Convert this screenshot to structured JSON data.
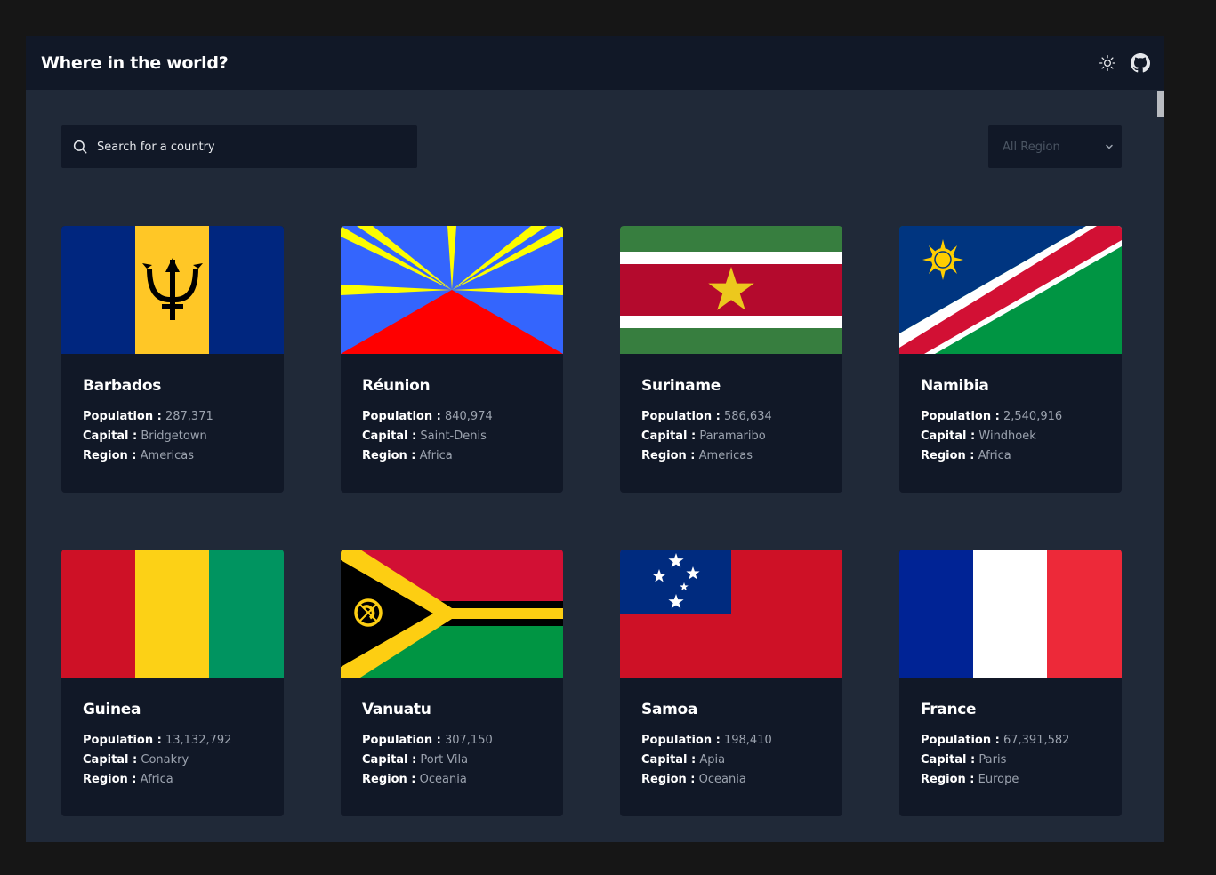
{
  "header": {
    "title": "Where in the world?",
    "theme_icon": "sun-icon",
    "github_icon": "github-icon"
  },
  "search": {
    "placeholder": "Search for a country",
    "icon": "search-icon"
  },
  "filter": {
    "selected": "All Region"
  },
  "labels": {
    "population": "Population :",
    "capital": "Capital :",
    "region": "Region :"
  },
  "countries": [
    {
      "name": "Barbados",
      "population": "287,371",
      "capital": "Bridgetown",
      "region": "Americas",
      "flag": "barbados"
    },
    {
      "name": "Réunion",
      "population": "840,974",
      "capital": "Saint-Denis",
      "region": "Africa",
      "flag": "reunion"
    },
    {
      "name": "Suriname",
      "population": "586,634",
      "capital": "Paramaribo",
      "region": "Americas",
      "flag": "suriname"
    },
    {
      "name": "Namibia",
      "population": "2,540,916",
      "capital": "Windhoek",
      "region": "Africa",
      "flag": "namibia"
    },
    {
      "name": "Guinea",
      "population": "13,132,792",
      "capital": "Conakry",
      "region": "Africa",
      "flag": "guinea"
    },
    {
      "name": "Vanuatu",
      "population": "307,150",
      "capital": "Port Vila",
      "region": "Oceania",
      "flag": "vanuatu"
    },
    {
      "name": "Samoa",
      "population": "198,410",
      "capital": "Apia",
      "region": "Oceania",
      "flag": "samoa"
    },
    {
      "name": "France",
      "population": "67,391,582",
      "capital": "Paris",
      "region": "Europe",
      "flag": "france"
    }
  ],
  "colors": {
    "page_background": "#161616",
    "app_background": "#202938",
    "surface": "#111827",
    "text_primary": "#ffffff",
    "text_secondary": "#9ca3af"
  }
}
